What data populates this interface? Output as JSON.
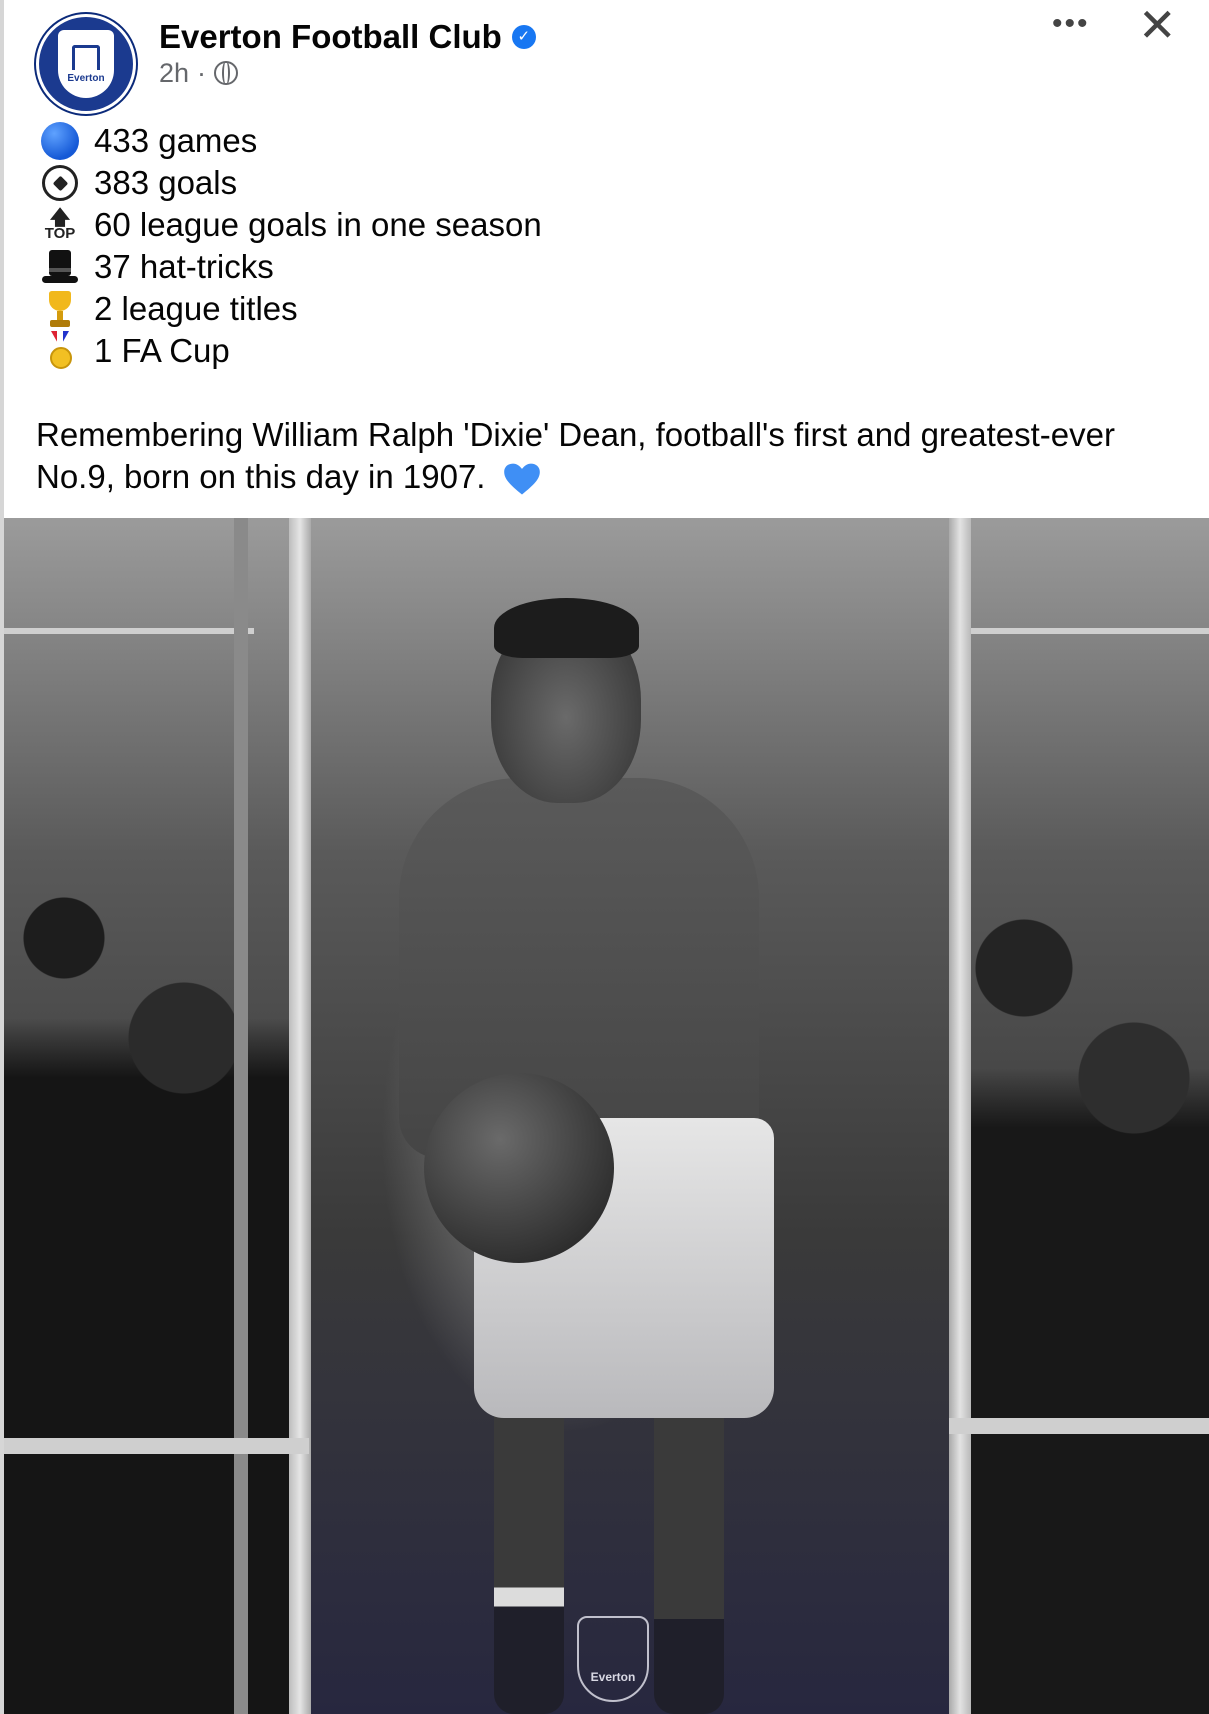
{
  "post": {
    "author": "Everton Football Club",
    "time": "2h",
    "separator": "·",
    "more_label": "•••",
    "close_label": "✕",
    "crest_text": "Everton"
  },
  "stats": [
    {
      "icon": "blue-circle-icon",
      "text": "433 games"
    },
    {
      "icon": "soccer-ball-icon",
      "text": "383 goals"
    },
    {
      "icon": "top-arrow-icon",
      "text": "60 league goals in one season"
    },
    {
      "icon": "top-hat-icon",
      "text": "37 hat-tricks"
    },
    {
      "icon": "trophy-icon",
      "text": "2 league titles"
    },
    {
      "icon": "medal-icon",
      "text": "1 FA Cup"
    }
  ],
  "top_label": "TOP",
  "caption": "Remembering William Ralph 'Dixie' Dean, football's first and greatest-ever No.9, born on this day in 1907.",
  "photo": {
    "watermark_text": "Everton"
  },
  "colors": {
    "accent": "#1877f2",
    "club_blue": "#1b3a8f",
    "heart": "#3f8ff5"
  }
}
